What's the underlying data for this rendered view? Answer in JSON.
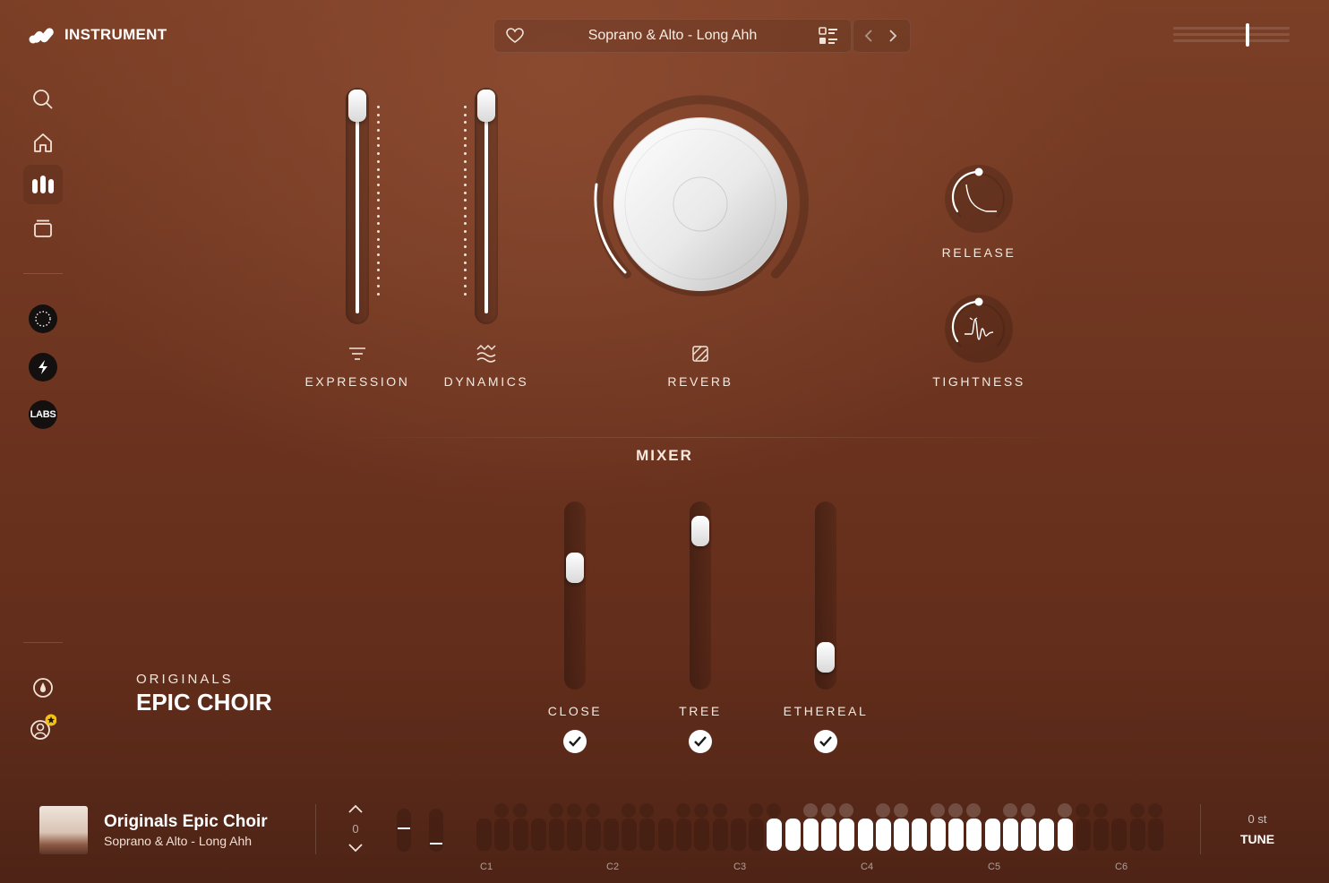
{
  "header": {
    "app_name": "INSTRUMENT",
    "preset_name": "Soprano & Alto - Long Ahh",
    "favorite_icon": "heart-icon",
    "browse_icon": "list-icon",
    "prev_icon": "chevron-left-icon",
    "next_icon": "chevron-right-icon",
    "master_volume": 0.64
  },
  "sidebar": {
    "items": [
      {
        "name": "search",
        "icon": "search-icon"
      },
      {
        "name": "home",
        "icon": "home-icon"
      },
      {
        "name": "instrument",
        "icon": "instrument-icon",
        "active": true
      },
      {
        "name": "library",
        "icon": "library-icon"
      }
    ],
    "partners": [
      {
        "name": "partner-a",
        "icon": "ring-logo-icon"
      },
      {
        "name": "spitfire",
        "icon": "spitfire-logo-icon"
      },
      {
        "name": "labs",
        "text": "LABS"
      }
    ],
    "bottom": [
      {
        "name": "droplet",
        "icon": "droplet-icon"
      },
      {
        "name": "account",
        "icon": "user-star-icon"
      }
    ]
  },
  "controls": {
    "expression": {
      "label": "EXPRESSION",
      "value": 1.0
    },
    "dynamics": {
      "label": "DYNAMICS",
      "value": 1.0
    },
    "reverb": {
      "label": "REVERB"
    },
    "release": {
      "label": "RELEASE"
    },
    "tightness": {
      "label": "TIGHTNESS"
    }
  },
  "mixer": {
    "title": "MIXER",
    "channels": [
      {
        "label": "CLOSE",
        "level": 0.68,
        "enabled": true
      },
      {
        "label": "TREE",
        "level": 0.92,
        "enabled": true
      },
      {
        "label": "ETHEREAL",
        "level": 0.1,
        "enabled": true
      }
    ]
  },
  "brand": {
    "line1": "ORIGINALS",
    "line2": "EPIC CHOIR"
  },
  "footer": {
    "title": "Originals Epic Choir",
    "subtitle": "Soprano & Alto - Long Ahh",
    "octave_value": "0",
    "octaves": [
      "C1",
      "C2",
      "C3",
      "C4",
      "C5",
      "C6"
    ],
    "tune_value": "0 st",
    "tune_label": "TUNE"
  },
  "colors": {
    "accent": "#ffffff",
    "background": "#6e3520"
  }
}
